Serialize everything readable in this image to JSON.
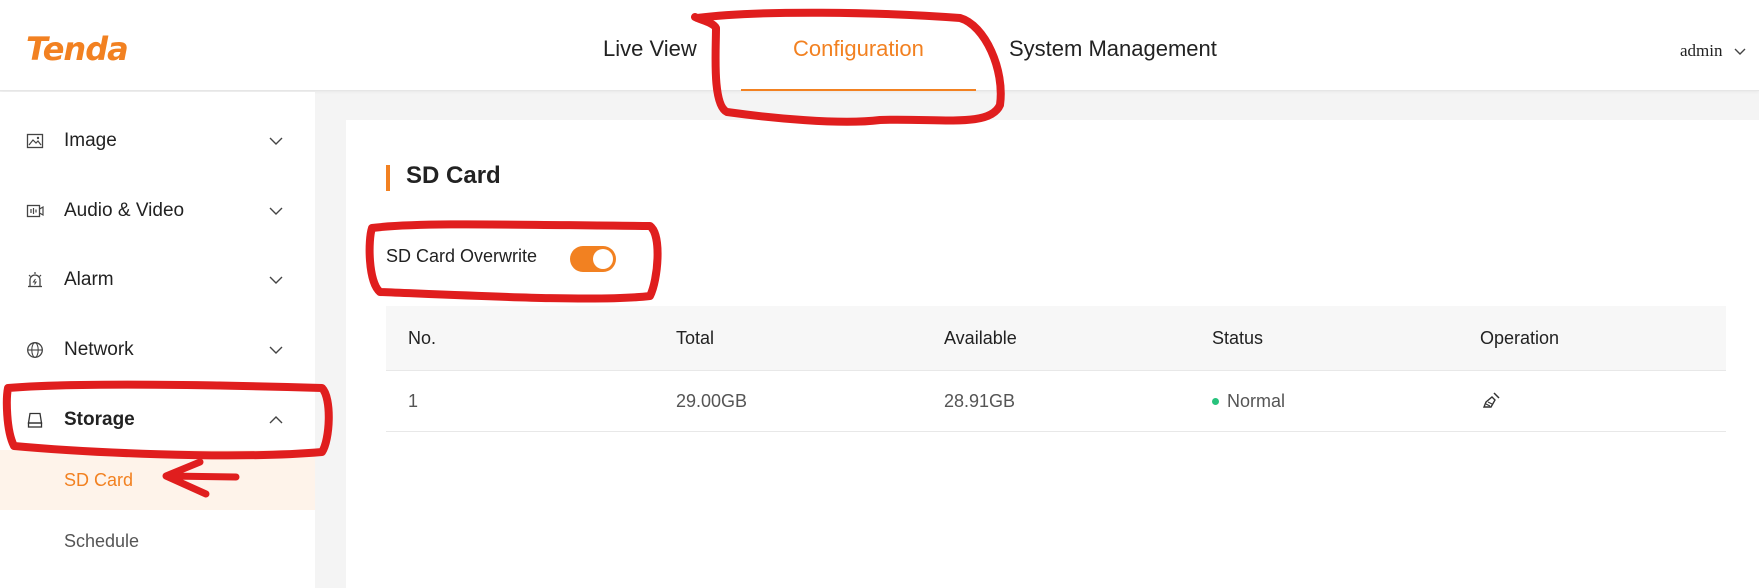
{
  "header": {
    "logo": "Tenda",
    "tabs": [
      {
        "label": "Live View",
        "active": false
      },
      {
        "label": "Configuration",
        "active": true
      },
      {
        "label": "System Management",
        "active": false
      }
    ],
    "user": "admin"
  },
  "sidebar": {
    "items": [
      {
        "label": "Image",
        "icon": "image-icon",
        "expanded": false
      },
      {
        "label": "Audio & Video",
        "icon": "audio-video-icon",
        "expanded": false
      },
      {
        "label": "Alarm",
        "icon": "alarm-icon",
        "expanded": false
      },
      {
        "label": "Network",
        "icon": "globe-icon",
        "expanded": false
      },
      {
        "label": "Storage",
        "icon": "storage-icon",
        "expanded": true,
        "children": [
          {
            "label": "SD Card",
            "active": true
          },
          {
            "label": "Schedule",
            "active": false
          }
        ]
      }
    ]
  },
  "main": {
    "title": "SD Card",
    "overwrite": {
      "label": "SD Card Overwrite",
      "enabled": true
    },
    "table": {
      "columns": [
        "No.",
        "Total",
        "Available",
        "Status",
        "Operation"
      ],
      "rows": [
        {
          "no": "1",
          "total": "29.00GB",
          "available": "28.91GB",
          "status": "Normal",
          "operation_icon": "format-brush-icon"
        }
      ]
    }
  },
  "colors": {
    "accent": "#f28121",
    "status_normal": "#27c27c",
    "annotation": "#e01e1e"
  }
}
